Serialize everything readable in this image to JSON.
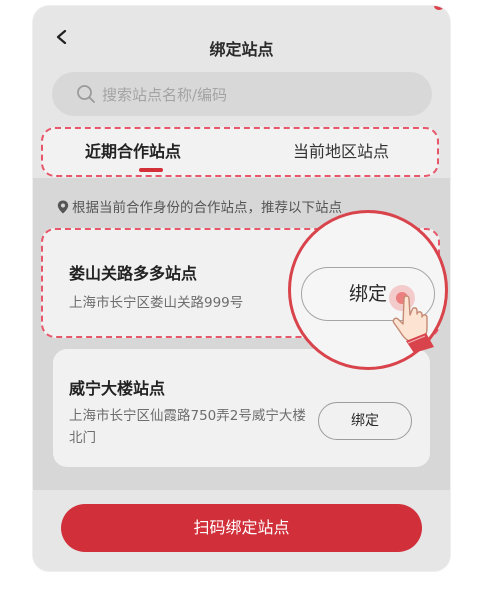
{
  "header": {
    "title": "绑定站点",
    "back_icon": "chevron-left-icon"
  },
  "search": {
    "placeholder": "搜索站点名称/编码",
    "icon": "search-icon"
  },
  "tabs": [
    {
      "label": "近期合作站点",
      "active": true
    },
    {
      "label": "当前地区站点",
      "active": false
    }
  ],
  "hint": {
    "text": "根据当前合作身份的合作站点，推荐以下站点",
    "icon": "location-pin-icon"
  },
  "stations": [
    {
      "name": "娄山关路多多站点",
      "address": "上海市长宁区娄山关路999号",
      "bind_label": "绑定"
    },
    {
      "name": "威宁大楼站点",
      "address": "上海市长宁区仙霞路750弄2号威宁大楼北门",
      "bind_label": "绑定"
    }
  ],
  "scan_button": {
    "label": "扫码绑定站点"
  },
  "colors": {
    "accent": "#d12f3a",
    "dashed_highlight": "#e8566a",
    "background": "#e6e6e6"
  }
}
